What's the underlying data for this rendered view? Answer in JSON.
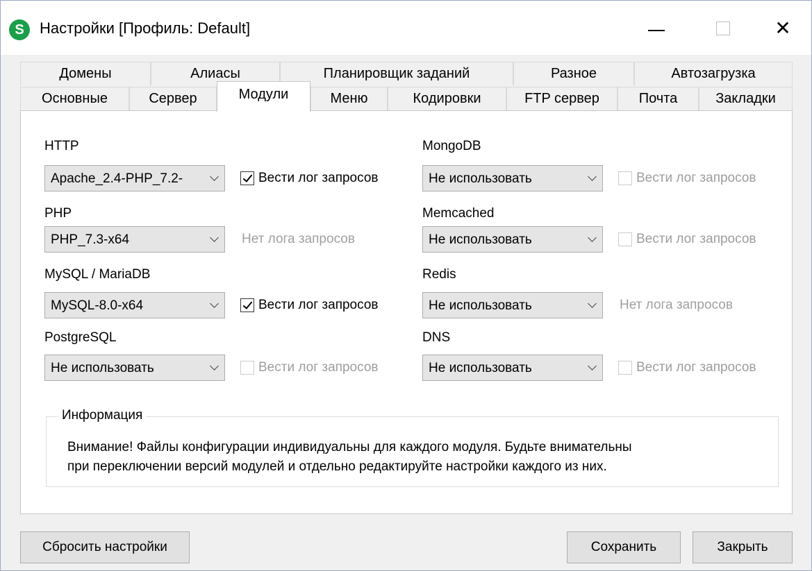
{
  "window": {
    "title": "Настройки [Профиль: Default]",
    "icon_letter": "S",
    "icon_color": "#1c9e4b"
  },
  "tabs": {
    "back_row": [
      "Домены",
      "Алиасы",
      "Планировщик заданий",
      "Разное",
      "Автозагрузка"
    ],
    "front_row": [
      "Основные",
      "Сервер",
      "Модули",
      "Меню",
      "Кодировки",
      "FTP сервер",
      "Почта",
      "Закладки"
    ],
    "active": "Модули"
  },
  "modules": {
    "http": {
      "label": "HTTP",
      "value": "Apache_2.4-PHP_7.2-",
      "log_label": "Вести лог запросов",
      "log_checked": true,
      "log_enabled": true
    },
    "php": {
      "label": "PHP",
      "value": "PHP_7.3-x64",
      "log_text": "Нет лога запросов"
    },
    "mysql": {
      "label": "MySQL / MariaDB",
      "value": "MySQL-8.0-x64",
      "log_label": "Вести лог запросов",
      "log_checked": true,
      "log_enabled": true
    },
    "postgresql": {
      "label": "PostgreSQL",
      "value": "Не использовать",
      "log_label": "Вести лог запросов",
      "log_checked": false,
      "log_enabled": false
    },
    "mongodb": {
      "label": "MongoDB",
      "value": "Не использовать",
      "log_label": "Вести лог запросов",
      "log_checked": false,
      "log_enabled": false
    },
    "memcached": {
      "label": "Memcached",
      "value": "Не использовать",
      "log_label": "Вести лог запросов",
      "log_checked": false,
      "log_enabled": false
    },
    "redis": {
      "label": "Redis",
      "value": "Не использовать",
      "log_text": "Нет лога запросов"
    },
    "dns": {
      "label": "DNS",
      "value": "Не использовать",
      "log_label": "Вести лог запросов",
      "log_checked": false,
      "log_enabled": false
    }
  },
  "info": {
    "title": "Информация",
    "line1": "Внимание! Файлы конфигурации индивидуальны для каждого модуля. Будьте внимательны",
    "line2": "при переключении версий модулей и отдельно редактируйте настройки каждого из них."
  },
  "buttons": {
    "reset": "Сбросить настройки",
    "save": "Сохранить",
    "close": "Закрыть"
  }
}
